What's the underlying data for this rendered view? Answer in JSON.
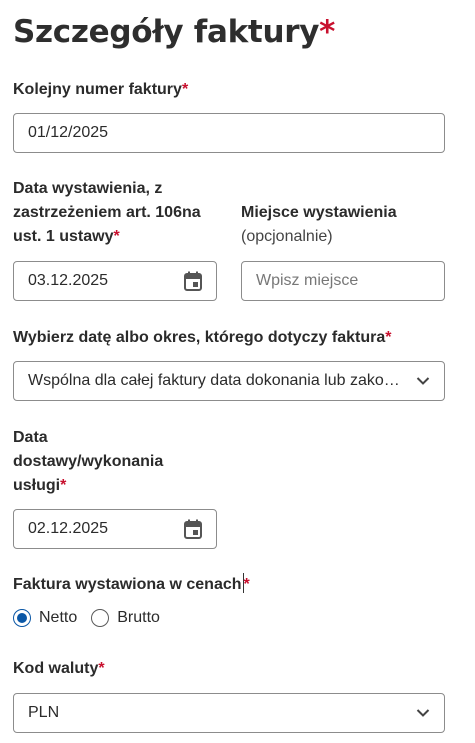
{
  "section": {
    "title": "Szczegóły faktury",
    "required_mark": "*"
  },
  "invoice_number": {
    "label": "Kolejny numer faktury",
    "required_mark": "*",
    "value": "01/12/2025"
  },
  "issue_date": {
    "label_line1": "Data wystawienia, z",
    "label_line2": "zastrzeżeniem art. 106na",
    "label_line3": "ust. 1 ustawy",
    "required_mark": "*",
    "value": "03.12.2025",
    "icon": "calendar-icon"
  },
  "issue_place": {
    "label": "Miejsce wystawienia",
    "optional_note": "(opcjonalnie)",
    "placeholder": "Wpisz miejsce"
  },
  "date_scope": {
    "label": "Wybierz datę albo okres, którego dotyczy faktura",
    "required_mark": "*",
    "selected": "Wspólna dla całej faktury data dokonania lub zakończenia dostawy",
    "icon": "chevron-down-icon"
  },
  "delivery_date": {
    "label_line1": "Data",
    "label_line2": "dostawy/wykonania",
    "label_line3": "usługi",
    "required_mark": "*",
    "value": "02.12.2025",
    "icon": "calendar-icon"
  },
  "price_basis": {
    "label": "Faktura wystawiona w cenach",
    "required_mark": "*",
    "options": [
      {
        "label": "Netto",
        "checked": true
      },
      {
        "label": "Brutto",
        "checked": false
      }
    ],
    "accent_color": "#0b57a6"
  },
  "currency": {
    "label": "Kod waluty",
    "required_mark": "*",
    "selected": "PLN",
    "icon": "chevron-down-icon"
  },
  "colors": {
    "required": "#c8102e",
    "border": "#8c8c8c",
    "text": "#2b2b2b"
  }
}
